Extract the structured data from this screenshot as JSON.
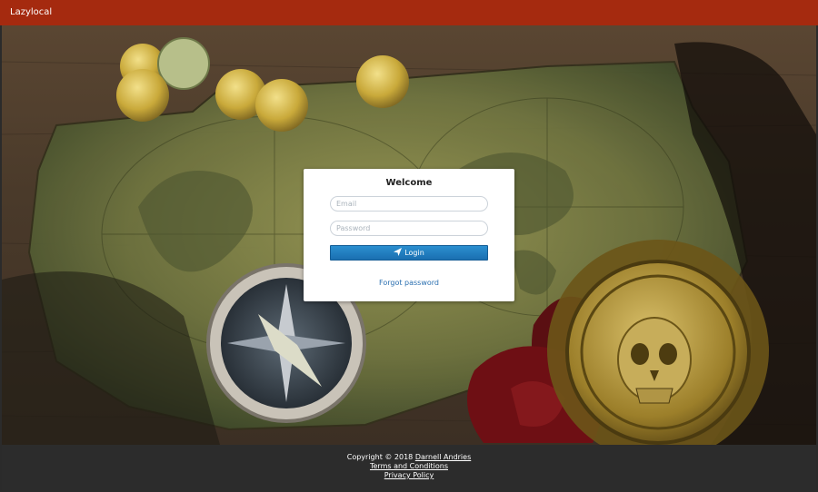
{
  "header": {
    "brand": "Lazylocal"
  },
  "login": {
    "title": "Welcome",
    "email_placeholder": "Email",
    "password_placeholder": "Password",
    "login_label": "Login",
    "forgot_label": "Forgot password"
  },
  "footer": {
    "copyright": "Copyright © 2018",
    "author": "Darnell Andries",
    "terms": "Terms and Conditions",
    "privacy": "Privacy Policy"
  },
  "colors": {
    "header_bg": "#a52a0f",
    "footer_bg": "#2c2c2c",
    "button_bg": "#1f7bbf",
    "link": "#2a6fb0"
  }
}
